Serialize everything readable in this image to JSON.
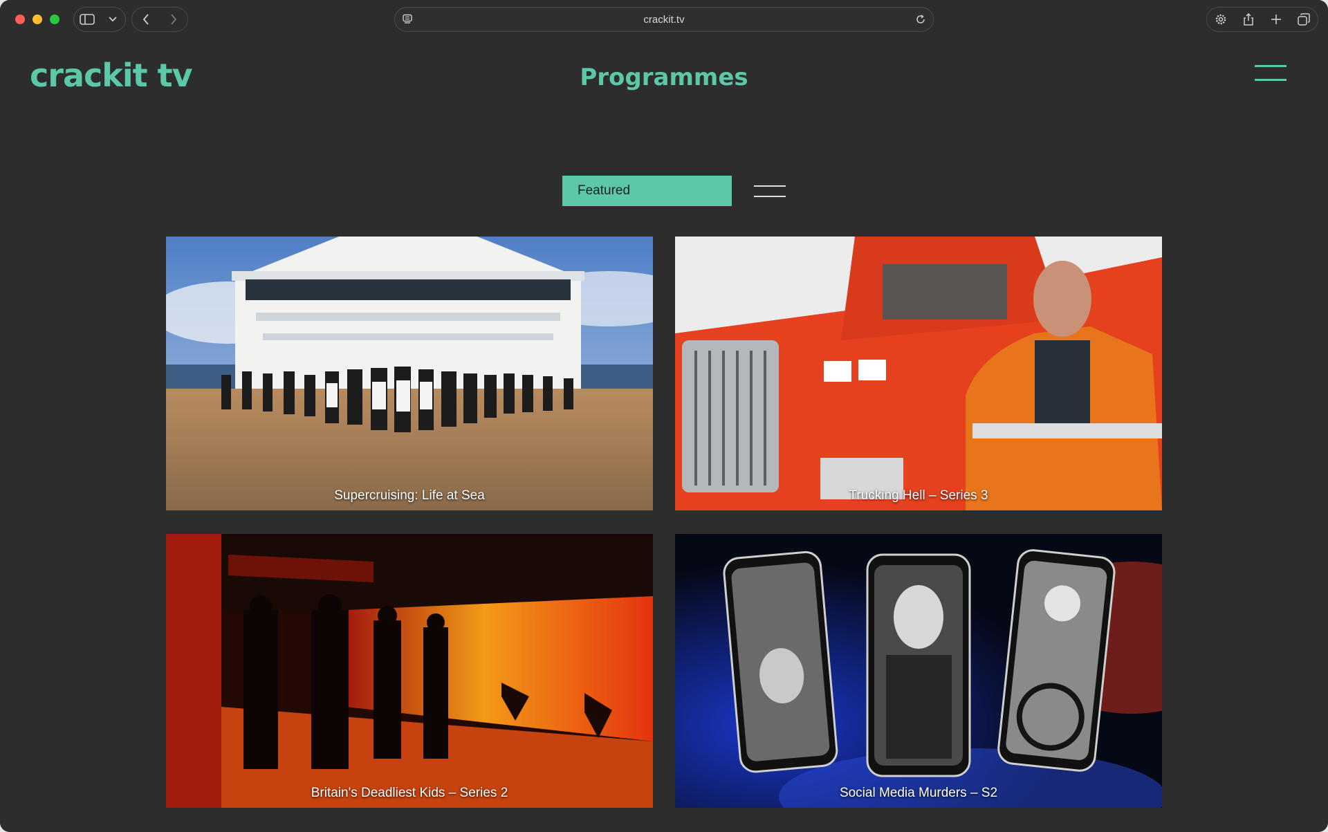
{
  "browser": {
    "url": "crackit.tv"
  },
  "site": {
    "logo": "crackit tv",
    "title": "Programmes"
  },
  "filter": {
    "selected": "Featured"
  },
  "programmes": [
    {
      "title": "Supercruising: Life at Sea"
    },
    {
      "title": "Trucking Hell – Series 3"
    },
    {
      "title": "Britain's Deadliest Kids – Series 2"
    },
    {
      "title": "Social Media Murders – S2"
    }
  ],
  "colors": {
    "brand": "#5cc8a8",
    "background": "#2d2d2d"
  }
}
